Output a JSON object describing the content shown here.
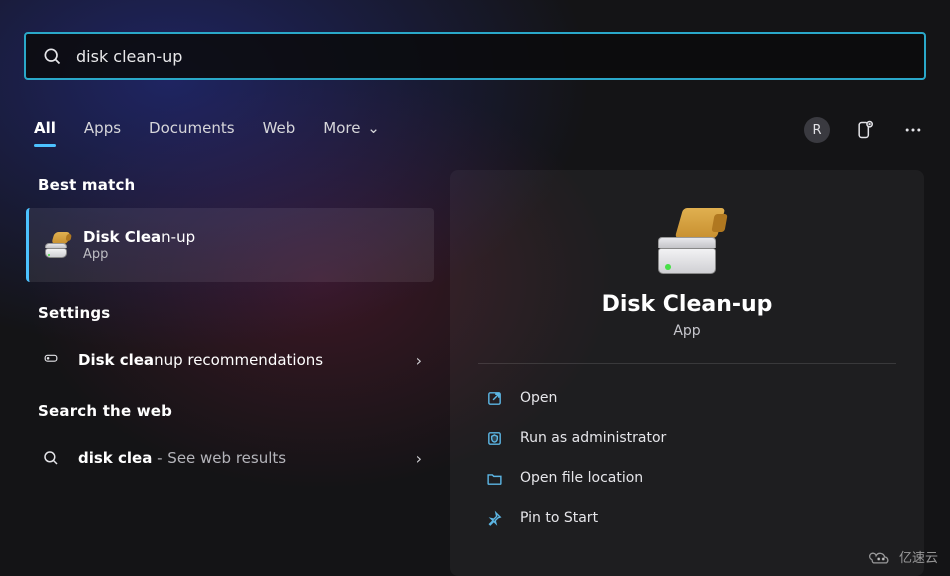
{
  "search": {
    "query": "disk clean-up"
  },
  "tabs": {
    "all": "All",
    "apps": "Apps",
    "documents": "Documents",
    "web": "Web",
    "more": "More"
  },
  "user": {
    "initial": "R"
  },
  "left": {
    "best_match": "Best match",
    "result": {
      "title_bold": "Disk Clea",
      "title_rest": "n-up",
      "subtitle": "App"
    },
    "settings_header": "Settings",
    "settings_item": {
      "bold": "Disk clea",
      "rest": "nup recommendations"
    },
    "web_header": "Search the web",
    "web_item": {
      "bold": "disk clea",
      "suffix": " - See web results"
    }
  },
  "detail": {
    "title": "Disk Clean-up",
    "subtitle": "App",
    "actions": {
      "open": "Open",
      "admin": "Run as administrator",
      "location": "Open file location",
      "pin": "Pin to Start"
    }
  },
  "watermark": "亿速云"
}
